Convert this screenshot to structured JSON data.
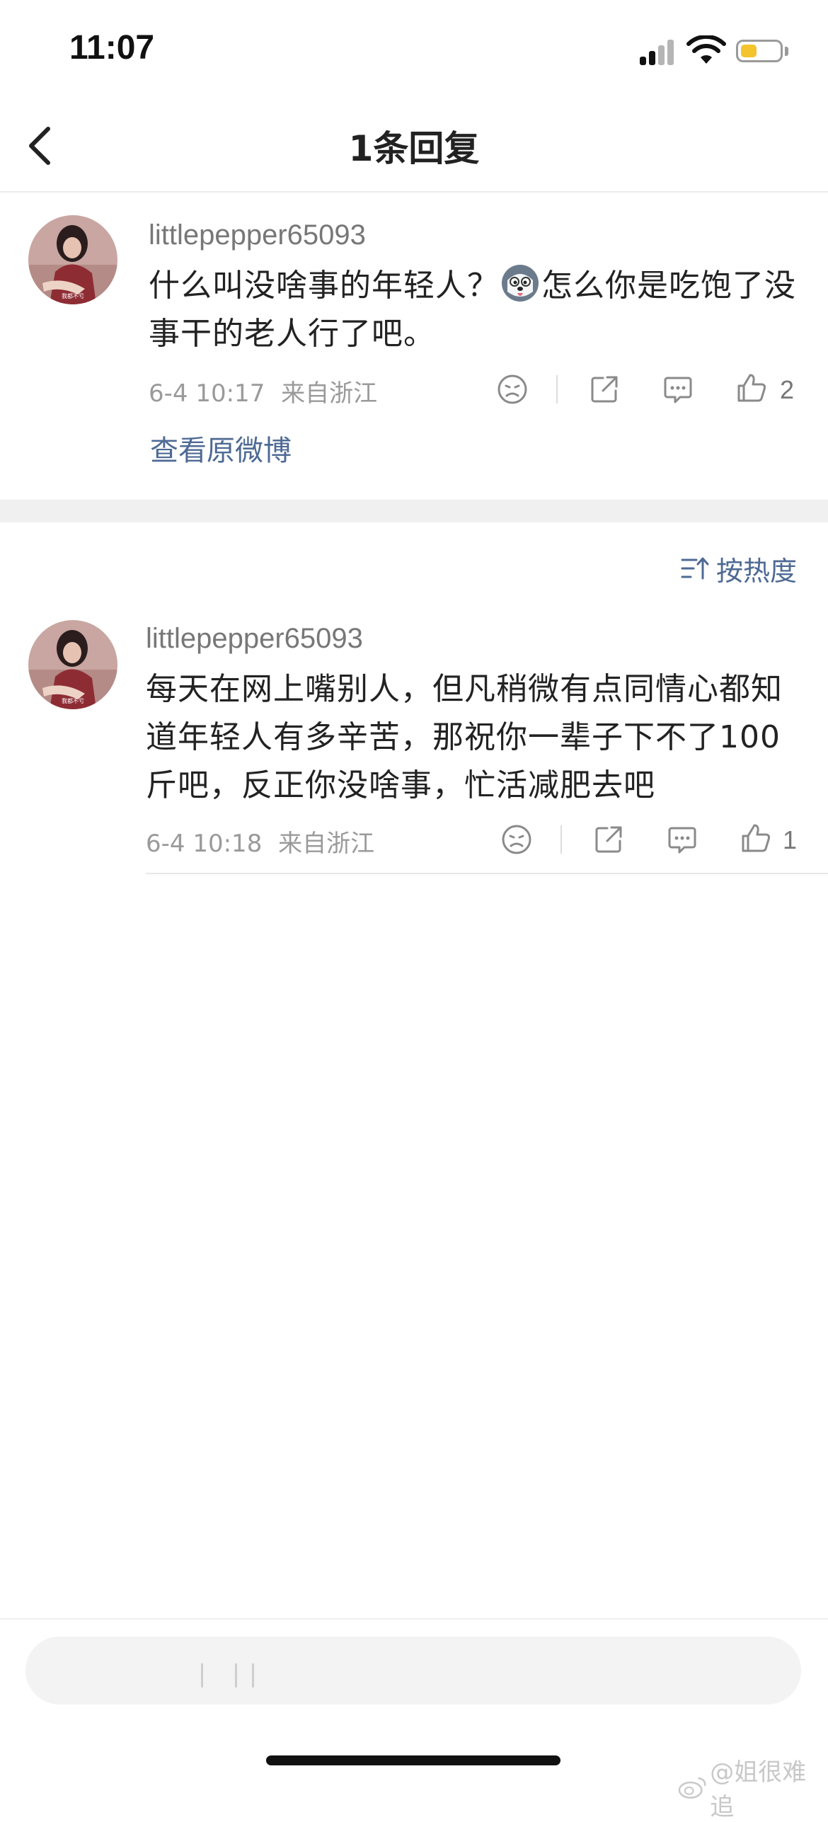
{
  "status_bar": {
    "time": "11:07",
    "battery_color": "#f3c42c"
  },
  "nav": {
    "title": "1条回复",
    "back_icon": "chevron-left-icon"
  },
  "root_comment": {
    "username": "littlepepper65093",
    "text_before_emoji": "什么叫没啥事的年轻人？",
    "emoji": "husky-emoji",
    "text_after_emoji": "怎么你是吃饱了没事干的老人行了吧。",
    "time": "6-4 10:17",
    "location": "来自浙江",
    "like_count": "2",
    "view_original": "查看原微博"
  },
  "sort": {
    "label": "按热度",
    "icon": "sort-icon"
  },
  "replies": [
    {
      "username": "littlepepper65093",
      "text": "每天在网上嘴别人，但凡稍微有点同情心都知道年轻人有多辛苦，那祝你一辈子下不了100斤吧，反正你没啥事，忙活减肥去吧",
      "time": "6-4 10:18",
      "location": "来自浙江",
      "like_count": "1"
    }
  ],
  "watermark": "@姐很难追",
  "colors": {
    "link": "#4e6a94",
    "separator": "#f0f0f0"
  }
}
